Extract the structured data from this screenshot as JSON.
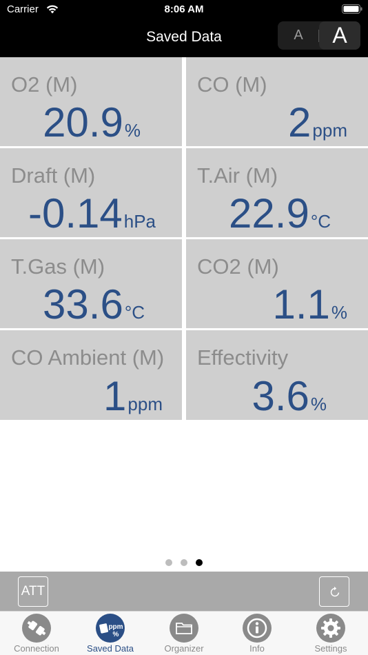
{
  "status": {
    "carrier": "Carrier",
    "time": "8:06 AM"
  },
  "nav": {
    "title": "Saved Data",
    "font_small": "A",
    "font_large": "A"
  },
  "readings": [
    {
      "label": "O2 (M)",
      "value": "20.9",
      "unit": "%"
    },
    {
      "label": "CO (M)",
      "value": "2",
      "unit": "ppm"
    },
    {
      "label": "Draft (M)",
      "value": "-0.14",
      "unit": "hPa"
    },
    {
      "label": "T.Air (M)",
      "value": "22.9",
      "unit": "°C"
    },
    {
      "label": "T.Gas (M)",
      "value": "33.6",
      "unit": "°C"
    },
    {
      "label": "CO2 (M)",
      "value": "1.1",
      "unit": "%"
    },
    {
      "label": "CO Ambient (M)",
      "value": "1",
      "unit": "ppm"
    },
    {
      "label": "Effectivity",
      "value": "3.6",
      "unit": "%"
    }
  ],
  "pager": {
    "pages": 3,
    "current": 3
  },
  "toolbar": {
    "att_label": "ATT",
    "refresh_icon": "refresh-icon"
  },
  "tabs": [
    {
      "label": "Connection",
      "icon": "connection-icon",
      "active": false
    },
    {
      "label": "Saved Data",
      "icon": "saved-data-icon",
      "active": true,
      "icon_text_top": "ppm",
      "icon_text_bottom": "%"
    },
    {
      "label": "Organizer",
      "icon": "folder-icon",
      "active": false
    },
    {
      "label": "Info",
      "icon": "info-icon",
      "active": false
    },
    {
      "label": "Settings",
      "icon": "gear-icon",
      "active": false
    }
  ],
  "colors": {
    "accent": "#2b4f86",
    "cell_bg": "#cfcfcf",
    "label": "#8c8c8c"
  }
}
